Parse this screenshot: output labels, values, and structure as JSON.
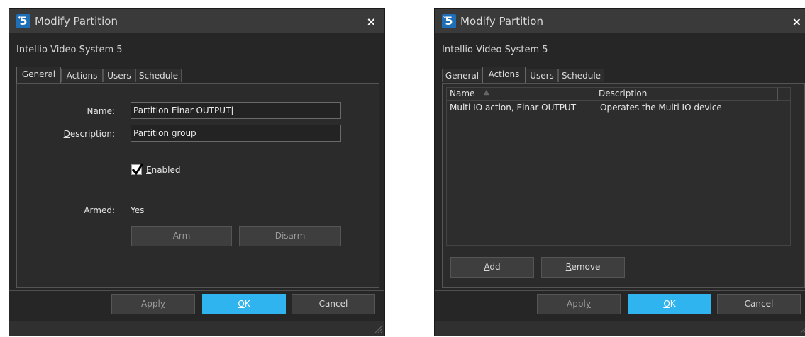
{
  "colors": {
    "dialog_bg": "#262626",
    "titlebar_bg": "#3a3a3a",
    "accent": "#2fb4f0",
    "logo_blue": "#1e6fb8"
  },
  "dialog1": {
    "title": "Modify Partition",
    "close": "×",
    "system_name": "Intellio Video System 5",
    "tabs": [
      "General",
      "Actions",
      "Users",
      "Schedule"
    ],
    "active_tab": "General",
    "name_label": "Name:",
    "name_value": "Partition Einar OUTPUT",
    "description_label": "Description:",
    "description_value": "Partition group",
    "enabled_label": "Enabled",
    "enabled_checked": true,
    "armed_label": "Armed:",
    "armed_value": "Yes",
    "arm_button": "Arm",
    "disarm_button": "Disarm",
    "apply_button": "Apply",
    "ok_button": "OK",
    "cancel_button": "Cancel"
  },
  "dialog2": {
    "title": "Modify Partition",
    "close": "×",
    "system_name": "Intellio Video System 5",
    "tabs": [
      "General",
      "Actions",
      "Users",
      "Schedule"
    ],
    "active_tab": "Actions",
    "columns": [
      "Name",
      "Description"
    ],
    "rows": [
      {
        "name": "Multi IO action, Einar OUTPUT",
        "description": "Operates the Multi IO device"
      }
    ],
    "add_button": "Add",
    "remove_button": "Remove",
    "apply_button": "Apply",
    "ok_button": "OK",
    "cancel_button": "Cancel"
  }
}
